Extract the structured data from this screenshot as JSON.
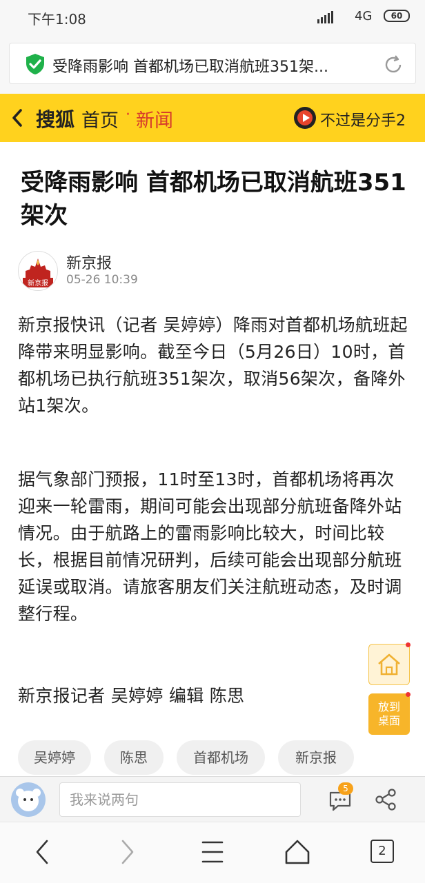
{
  "status_bar": {
    "time": "下午1:08",
    "network": "4G",
    "battery": "60"
  },
  "url_bar": {
    "text": "受降雨影响 首都机场已取消航班351架..."
  },
  "nav": {
    "brand": "搜狐",
    "home": "首页",
    "separator": "·",
    "section": "新闻",
    "song": "不过是分手2"
  },
  "article": {
    "title": "受降雨影响 首都机场已取消航班351架次",
    "source": "新京报",
    "logo_text": "新京报",
    "time": "05-26 10:39",
    "paragraphs": [
      "新京报快讯（记者 吴婷婷）降雨对首都机场航班起降带来明显影响。截至今日（5月26日）10时，首都机场已执行航班351架次，取消56架次，备降外站1架次。",
      "据气象部门预报，11时至13时，首都机场将再次迎来一轮雷雨，期间可能会出现部分航班备降外站情况。由于航路上的雷雨影响比较大，时间比较长，根据目前情况研判，后续可能会出现部分航班延误或取消。请旅客朋友们关注航班动态，及时调整行程。",
      "新京报记者 吴婷婷 编辑 陈思"
    ],
    "tags": [
      "吴婷婷",
      "陈思",
      "首都机场",
      "新京报"
    ]
  },
  "floating": {
    "desktop_label_1": "放到",
    "desktop_label_2": "桌面"
  },
  "comment_bar": {
    "placeholder": "我来说两句",
    "comment_count": "5"
  },
  "bottom_bar": {
    "tab_count": "2"
  },
  "colors": {
    "nav_yellow": "#ffd21e",
    "accent_red": "#d63a2c",
    "badge_orange": "#f7a21b"
  }
}
